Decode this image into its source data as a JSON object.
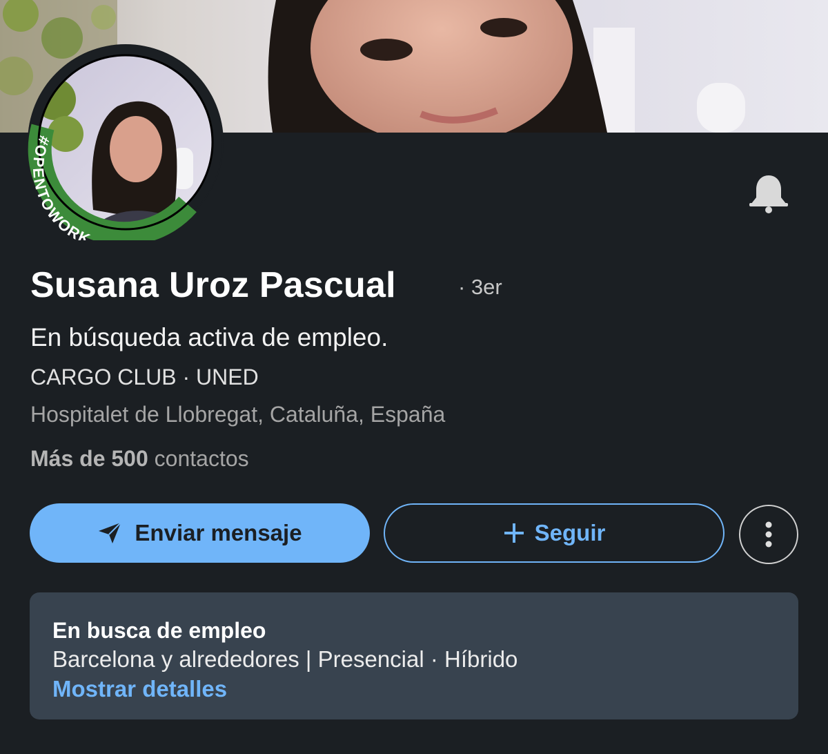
{
  "profile": {
    "name": "Susana Uroz Pascual",
    "degree": "· 3er",
    "headline": "En búsqueda activa de empleo.",
    "company": "CARGO CLUB · UNED",
    "location": "Hospitalet de Llobregat, Cataluña, España",
    "connections_count": "Más de 500",
    "connections_label": "contactos",
    "open_to_work_badge": "#OPENTOWORK"
  },
  "actions": {
    "message_label": "Enviar mensaje",
    "follow_label": "Seguir",
    "more_icon": "more-vertical-icon",
    "bell_icon": "bell-icon"
  },
  "open_to_work_card": {
    "title": "En busca de empleo",
    "detail": "Barcelona y alrededores | Presencial · Híbrido",
    "link": "Mostrar detalles"
  },
  "colors": {
    "background": "#1b1f23",
    "accent": "#70b5f9",
    "card": "#38434f",
    "open_to_work_ring": "#3c8b3a"
  }
}
